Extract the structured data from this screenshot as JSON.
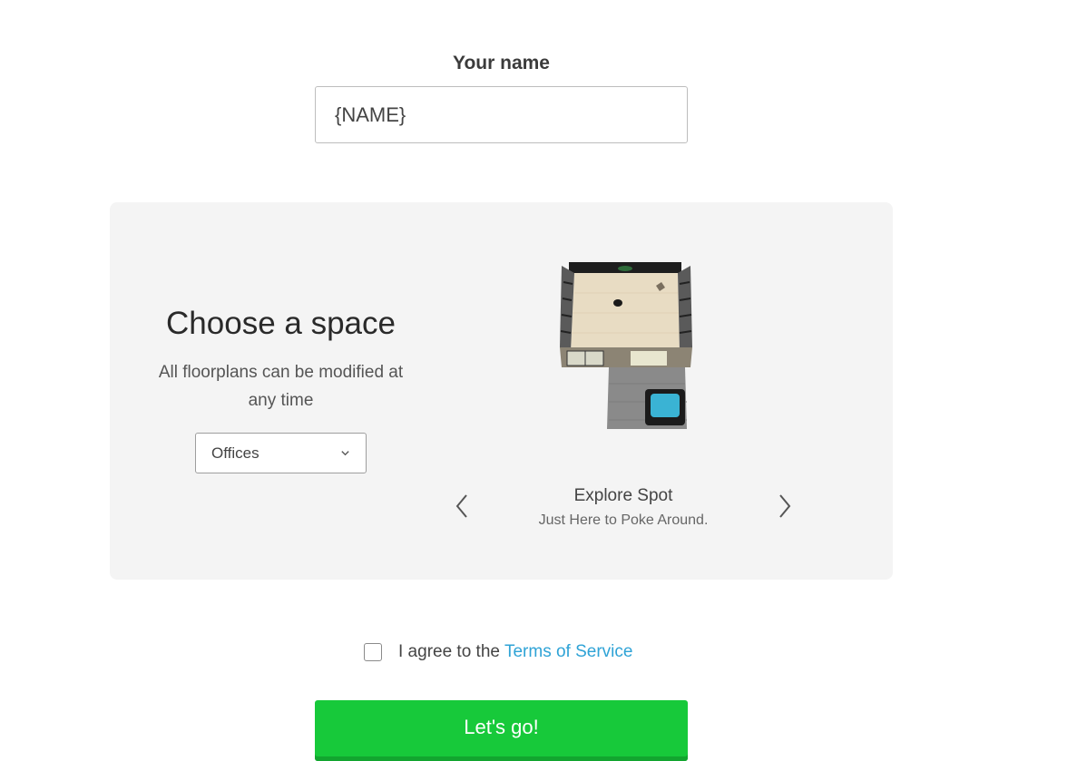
{
  "name_section": {
    "label": "Your name",
    "input_value": "{NAME}"
  },
  "space_section": {
    "title": "Choose a space",
    "subtitle": "All floorplans can be modified at any time",
    "select_value": "Offices",
    "spot_title": "Explore Spot",
    "spot_subtitle": "Just Here to Poke Around.",
    "prev_icon": "chevron-left-icon",
    "next_icon": "chevron-right-icon"
  },
  "terms": {
    "text": "I agree to the",
    "link_text": "Terms of Service",
    "link_color": "#2fa3d6",
    "checked": false
  },
  "submit": {
    "label": "Let's go!",
    "color": "#17c93a"
  }
}
